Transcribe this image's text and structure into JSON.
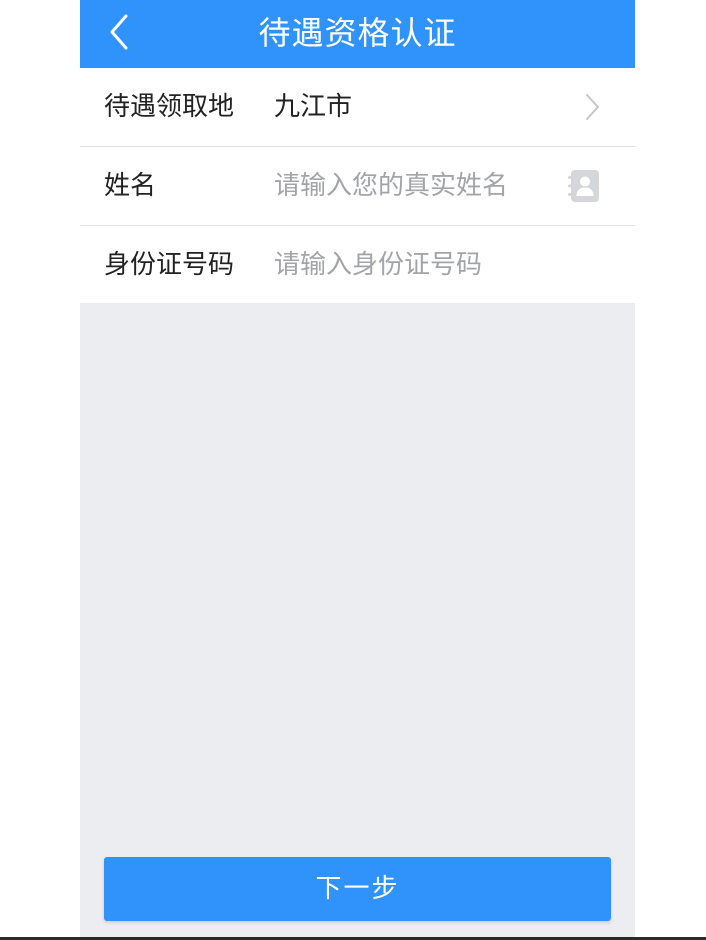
{
  "header": {
    "title": "待遇资格认证",
    "back_icon": "chevron-left-icon"
  },
  "form": {
    "region": {
      "label": "待遇领取地",
      "value": "九江市",
      "icon": "chevron-right-icon"
    },
    "name": {
      "label": "姓名",
      "placeholder": "请输入您的真实姓名",
      "value": "",
      "icon": "contact-book-icon"
    },
    "id_number": {
      "label": "身份证号码",
      "placeholder": "请输入身份证号码",
      "value": ""
    }
  },
  "actions": {
    "next_label": "下一步"
  },
  "colors": {
    "primary": "#2f93fb",
    "background": "#ecedf0",
    "text": "#222222",
    "placeholder": "#a2a4a8",
    "divider": "#e3e3e6"
  }
}
